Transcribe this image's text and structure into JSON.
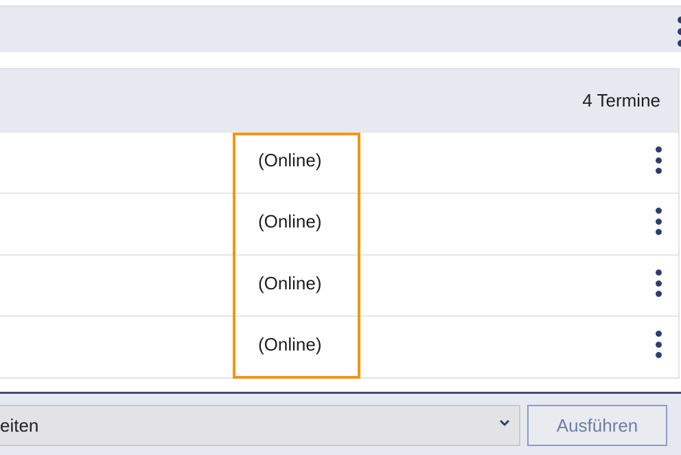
{
  "header": {
    "menu_icon": "kebab-vertical-icon"
  },
  "table": {
    "count_label": "4 Termine",
    "rows": [
      {
        "label": "(Online)",
        "menu_icon": "kebab-vertical-icon"
      },
      {
        "label": "(Online)",
        "menu_icon": "kebab-vertical-icon"
      },
      {
        "label": "(Online)",
        "menu_icon": "kebab-vertical-icon"
      },
      {
        "label": "(Online)",
        "menu_icon": "kebab-vertical-icon"
      }
    ]
  },
  "highlight": {
    "color": "#f3970c"
  },
  "actions": {
    "select_value": "eiten",
    "run_label": "Ausführen"
  },
  "colors": {
    "bar_background": "#e7e9f0",
    "accent_dark": "#2d3e6e"
  }
}
